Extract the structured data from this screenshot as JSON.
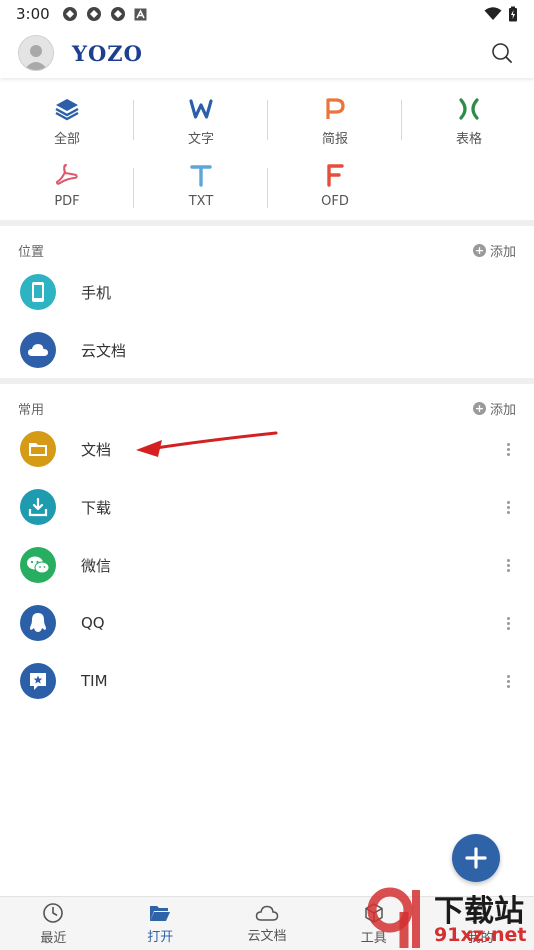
{
  "status_bar": {
    "time": "3:00"
  },
  "header": {
    "logo": "YOZO"
  },
  "file_types": [
    {
      "label": "全部",
      "icon": "layers-icon",
      "color": "#2b5fa8"
    },
    {
      "label": "文字",
      "icon": "w-icon",
      "color": "#2b5fa8"
    },
    {
      "label": "简报",
      "icon": "p-icon",
      "color": "#e9743c"
    },
    {
      "label": "表格",
      "icon": "x-icon",
      "color": "#2e8b4a"
    },
    {
      "label": "PDF",
      "icon": "pdf-icon",
      "color": "#e0566c"
    },
    {
      "label": "TXT",
      "icon": "t-icon",
      "color": "#5fa6d8"
    },
    {
      "label": "OFD",
      "icon": "f-icon",
      "color": "#e54d3c"
    }
  ],
  "location": {
    "title": "位置",
    "add_label": "添加",
    "items": [
      {
        "label": "手机",
        "icon": "phone-icon",
        "color": "#2db3c1"
      },
      {
        "label": "云文档",
        "icon": "cloud-icon",
        "color": "#2f5fa8"
      }
    ]
  },
  "common": {
    "title": "常用",
    "add_label": "添加",
    "items": [
      {
        "label": "文档",
        "icon": "folder-icon",
        "color": "#d59a16"
      },
      {
        "label": "下载",
        "icon": "download-icon",
        "color": "#1f9bb0"
      },
      {
        "label": "微信",
        "icon": "wechat-icon",
        "color": "#27ae60"
      },
      {
        "label": "QQ",
        "icon": "qq-icon",
        "color": "#2b5fa8"
      },
      {
        "label": "TIM",
        "icon": "tim-icon",
        "color": "#2b5fa8"
      }
    ]
  },
  "bottom_nav": [
    {
      "label": "最近",
      "icon": "clock-icon"
    },
    {
      "label": "打开",
      "icon": "open-folder-icon",
      "active": true
    },
    {
      "label": "云文档",
      "icon": "cloud-outline-icon"
    },
    {
      "label": "工具",
      "icon": "toolbox-icon"
    },
    {
      "label": "我的",
      "icon": "person-icon"
    }
  ],
  "watermark": {
    "text_top": "下载站",
    "text_bottom": "91xz.net"
  },
  "colors": {
    "accent": "#2f63a8",
    "annotation_arrow": "#d42020"
  }
}
